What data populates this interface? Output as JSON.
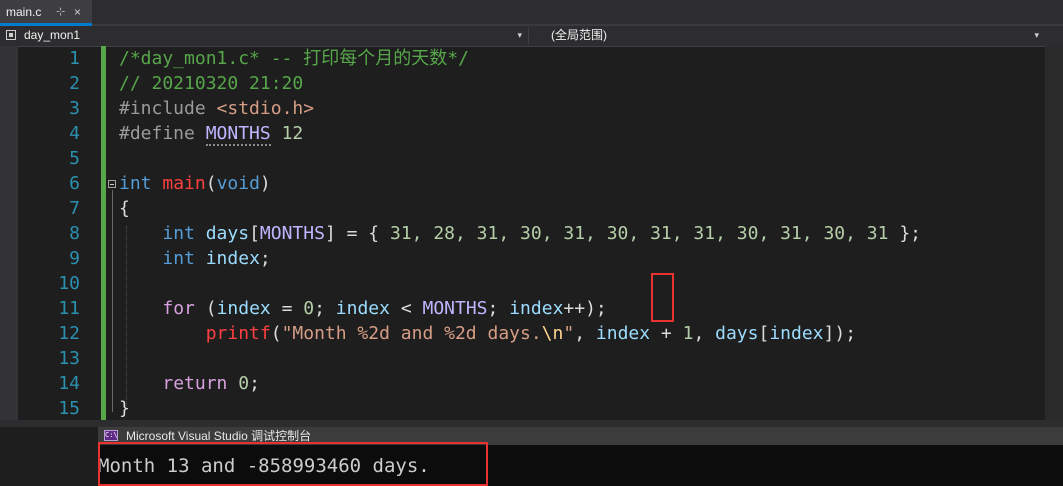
{
  "tab": {
    "label": "main.c",
    "pin": "⊹",
    "close": "×"
  },
  "nav": {
    "left": "day_mon1",
    "right": "(全局范围)"
  },
  "line_numbers": [
    "1",
    "2",
    "3",
    "4",
    "5",
    "6",
    "7",
    "8",
    "9",
    "10",
    "11",
    "12",
    "13",
    "14",
    "15"
  ],
  "code": {
    "l1": "/*day_mon1.c* -- 打印每个月的天数*/",
    "l2": "// 20210320 21:20",
    "l3_a": "#include ",
    "l3_b": "<stdio.h>",
    "l4_a": "#define ",
    "l4_b": "MONTHS",
    "l4_c": " 12",
    "l6_a": "int",
    "l6_b": " ",
    "l6_c": "main",
    "l6_d": "(",
    "l6_e": "void",
    "l6_f": ")",
    "l7": "{",
    "l8_a": "    ",
    "l8_b": "int",
    "l8_c": " ",
    "l8_d": "days",
    "l8_e": "[",
    "l8_f": "MONTHS",
    "l8_g": "] = { ",
    "l8_h": "31, 28, 31, 30, 31, 30, 31, 31, 30, 31, 30, 31",
    "l8_i": " };",
    "l9_a": "    ",
    "l9_b": "int",
    "l9_c": " ",
    "l9_d": "index",
    "l9_e": ";",
    "l11_a": "    ",
    "l11_b": "for",
    "l11_c": " (",
    "l11_d": "index",
    "l11_e": " = ",
    "l11_f": "0",
    "l11_g": "; ",
    "l11_h": "index",
    "l11_i": " < ",
    "l11_j": "MONTHS",
    "l11_k": "; ",
    "l11_l": "index",
    "l11_m": "++);",
    "l12_a": "        ",
    "l12_b": "printf",
    "l12_c": "(",
    "l12_d": "\"Month %2d and %2d days.",
    "l12_e": "\\n",
    "l12_f": "\"",
    "l12_g": ", ",
    "l12_h": "index",
    "l12_i": " + ",
    "l12_j": "1",
    "l12_k": ", ",
    "l12_l": "days",
    "l12_m": "[",
    "l12_n": "index",
    "l12_o": "]);",
    "l14_a": "    ",
    "l14_b": "return",
    "l14_c": " ",
    "l14_d": "0",
    "l14_e": ";",
    "l15": "}"
  },
  "console": {
    "icon": "C:\\",
    "title": "Microsoft Visual Studio 调试控制台",
    "output": "Month 13 and -858993460 days."
  }
}
